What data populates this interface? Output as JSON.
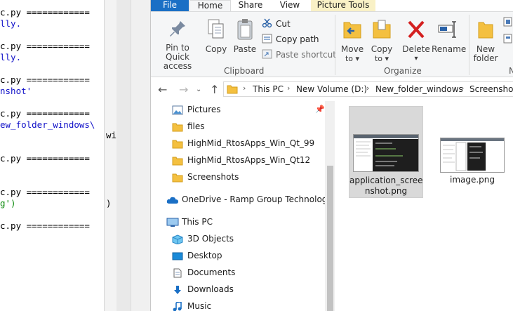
{
  "editor": {
    "lines": [
      {
        "text": "c.py ============",
        "cls": "blk"
      },
      {
        "text": "lly.",
        "cls": "blu"
      },
      {
        "text": "c.py ============",
        "cls": "blk"
      },
      {
        "text": "lly.",
        "cls": "blu"
      },
      {
        "text": "c.py ============",
        "cls": "blk"
      },
      {
        "text": "nshot'",
        "cls": "blu"
      },
      {
        "text": "c.py ============",
        "cls": "blk"
      },
      {
        "text": "ew_folder_windows\\",
        "cls": "blu"
      },
      {
        "text": "c.py ============",
        "cls": "blk"
      },
      {
        "text": "c.py ============",
        "cls": "blk"
      },
      {
        "text": "g')",
        "cls": "grn"
      },
      {
        "text": "c.py ============",
        "cls": "blk"
      }
    ],
    "overflow_win": "win",
    "overflow_paren": ")"
  },
  "ribbon": {
    "tabs": {
      "file": "File",
      "home": "Home",
      "share": "Share",
      "view": "View",
      "picture_tools": "Picture Tools"
    },
    "clipboard": {
      "pin_line1": "Pin to Quick",
      "pin_line2": "access",
      "copy": "Copy",
      "paste": "Paste",
      "cut": "Cut",
      "copy_path": "Copy path",
      "paste_shortcut": "Paste shortcut",
      "group_label": "Clipboard"
    },
    "organize": {
      "move_to": "Move",
      "move_to2": "to",
      "copy_to": "Copy",
      "copy_to2": "to",
      "delete": "Delete",
      "rename": "Rename",
      "group_label": "Organize"
    },
    "new": {
      "new_folder1": "New",
      "new_folder2": "folder",
      "group_label_partial": "N"
    }
  },
  "address": {
    "crumbs": [
      "This PC",
      "New Volume (D:)",
      "New_folder_windows",
      "Screenshots"
    ]
  },
  "navpane": {
    "quick_access": [
      "Pictures",
      "files",
      "HighMid_RtosApps_Win_Qt_99",
      "HighMid_RtosApps_Win_Qt12",
      "Screenshots"
    ],
    "onedrive": "OneDrive - Ramp Group Technologies",
    "this_pc": "This PC",
    "this_pc_items": [
      "3D Objects",
      "Desktop",
      "Documents",
      "Downloads",
      "Music"
    ]
  },
  "files": [
    {
      "name_line1": "application_scree",
      "name_line2": "nshot.png",
      "selected": true
    },
    {
      "name_line1": "image.png",
      "name_line2": "",
      "selected": false
    }
  ],
  "colors": {
    "accent": "#1a6fc5",
    "folder": "#f4c040",
    "picture_tools_tab": "#f9f1c6",
    "selection": "#d9d9d9"
  }
}
